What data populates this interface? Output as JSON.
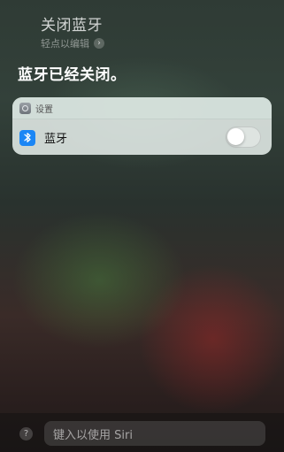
{
  "siri": {
    "query": "关闭蓝牙",
    "edit_hint": "轻点以编辑",
    "edit_chevron": "›",
    "response": "蓝牙已经关闭。"
  },
  "card": {
    "app_name": "设置",
    "app_icon": "settings-gear-icon",
    "row_label": "蓝牙",
    "row_icon": "bluetooth-icon",
    "toggle_state": "off"
  },
  "bottom": {
    "help_symbol": "?",
    "type_placeholder": "键入以使用 Siri"
  },
  "colors": {
    "bluetooth_accent": "#1b86f5"
  }
}
